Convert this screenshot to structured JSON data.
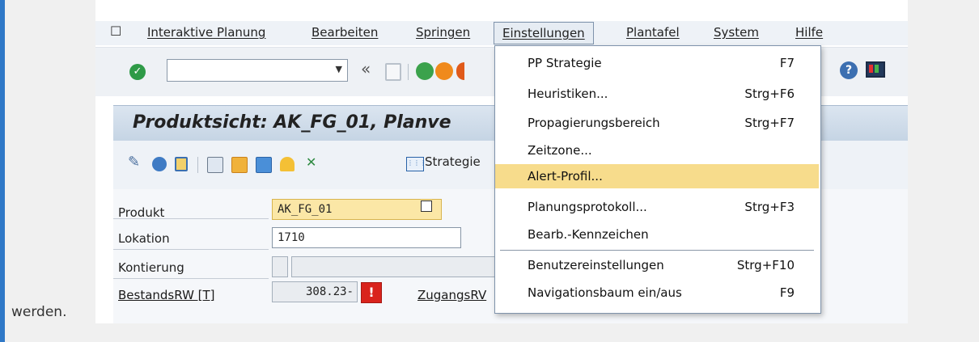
{
  "document": {
    "trailing_word": "werden."
  },
  "menubar": {
    "items": [
      {
        "label": "Interaktive Planung"
      },
      {
        "label": "Bearbeiten"
      },
      {
        "label": "Springen"
      },
      {
        "label": "Einstellungen",
        "active": true
      },
      {
        "label": "Plantafel"
      },
      {
        "label": "System"
      },
      {
        "label": "Hilfe"
      }
    ]
  },
  "toolbar": {
    "command_field_value": "",
    "back_glyph": "«",
    "icons": [
      "ok-icon",
      "command-field",
      "back-icon",
      "save-icon",
      "back-green-icon",
      "exit-orange-icon",
      "help-icon",
      "layout-monitor-icon"
    ]
  },
  "page": {
    "title": "Produktsicht: AK_FG_01, Planve"
  },
  "app_toolbar": {
    "icons": [
      "pencil-icon",
      "refresh-icon",
      "hierarchy-icon",
      "details-icon",
      "heuristic-icon",
      "calendar-icon",
      "alert-icon",
      "tools-icon",
      "strategy-icon"
    ],
    "strategy_label": "Strategie"
  },
  "form": {
    "produkt": {
      "label": "Produkt",
      "value": "AK_FG_01"
    },
    "lokation": {
      "label": "Lokation",
      "value": "1710"
    },
    "kontierung": {
      "label": "Kontierung",
      "value": ""
    },
    "bestandsrw": {
      "label": "BestandsRW [T]",
      "value": "308.23-",
      "status_icon": "!"
    },
    "zugangsrw": {
      "label": "ZugangsRV"
    }
  },
  "dropdown": {
    "items": [
      {
        "label": "PP Strategie",
        "shortcut": "F7"
      },
      {
        "label": "Heuristiken...",
        "shortcut": "Strg+F6"
      },
      {
        "label": "Propagierungsbereich",
        "shortcut": "Strg+F7"
      },
      {
        "label": "Zeitzone...",
        "shortcut": ""
      },
      {
        "label": "Alert-Profil...",
        "shortcut": "",
        "highlighted": true
      },
      {
        "label": "Planungsprotokoll...",
        "shortcut": "Strg+F3"
      },
      {
        "label": "Bearb.-Kennzeichen",
        "shortcut": ""
      },
      {
        "label": "Benutzereinstellungen",
        "shortcut": "Strg+F10"
      },
      {
        "label": "Navigationsbaum ein/aus",
        "shortcut": "F9"
      }
    ]
  },
  "colors": {
    "accent_rule": "#2f78c7",
    "highlight": "#f7dc8c",
    "field_highlight": "#fbe7a6",
    "title_gradient_start": "#dbe5f0",
    "warning": "#d9231c"
  }
}
